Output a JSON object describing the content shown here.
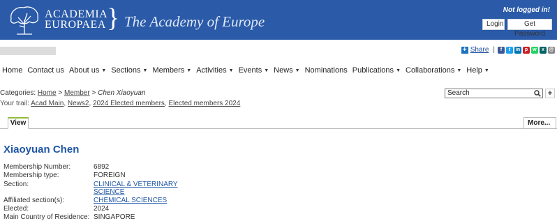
{
  "header": {
    "org_line1": "ACADEMIA",
    "org_line2": "EUROPAEA",
    "title": "The Academy of Europe",
    "login_status": "Not logged in!",
    "login_button": "Login",
    "password_button": "Get Password",
    "banner_color": "#2a5aa8"
  },
  "share": {
    "label": "Share",
    "services": [
      {
        "icon": "facebook-icon",
        "glyph": "f",
        "color": "#3b5998"
      },
      {
        "icon": "twitter-icon",
        "glyph": "t",
        "color": "#1da1f2"
      },
      {
        "icon": "linkedin-icon",
        "glyph": "in",
        "color": "#0077b5"
      },
      {
        "icon": "pinterest-icon",
        "glyph": "p",
        "color": "#cb2027"
      },
      {
        "icon": "whatsapp-icon",
        "glyph": "w",
        "color": "#25d366"
      },
      {
        "icon": "xing-icon",
        "glyph": "x",
        "color": "#026466"
      },
      {
        "icon": "email-icon",
        "glyph": "@",
        "color": "#888888"
      }
    ]
  },
  "nav": [
    {
      "label": "Home",
      "dropdown": false
    },
    {
      "label": "Contact us",
      "dropdown": false
    },
    {
      "label": "About us",
      "dropdown": true
    },
    {
      "label": "Sections",
      "dropdown": true
    },
    {
      "label": "Members",
      "dropdown": true
    },
    {
      "label": "Activities",
      "dropdown": true
    },
    {
      "label": "Events",
      "dropdown": true
    },
    {
      "label": "News",
      "dropdown": true
    },
    {
      "label": "Nominations",
      "dropdown": false
    },
    {
      "label": "Publications",
      "dropdown": true
    },
    {
      "label": "Collaborations",
      "dropdown": true
    },
    {
      "label": "Help",
      "dropdown": true
    }
  ],
  "breadcrumb": {
    "prefix": "Categories:",
    "home": "Home",
    "member": "Member",
    "current": "Chen Xiaoyuan",
    "sep": ">"
  },
  "trail": {
    "prefix": "Your trail:",
    "items": [
      "Acad Main",
      "News2",
      "2024 Elected members",
      "Elected members 2024"
    ]
  },
  "search": {
    "text": "Search"
  },
  "tabs": {
    "view": "View",
    "more": "More..."
  },
  "profile": {
    "name": "Xiaoyuan Chen",
    "fields": [
      {
        "label": "Membership Number:",
        "value": "6892",
        "link": false
      },
      {
        "label": "Membership type:",
        "value": "FOREIGN",
        "link": false
      },
      {
        "label": "Section:",
        "value": "CLINICAL & VETERINARY SCIENCE",
        "value_line1": "CLINICAL & VETERINARY",
        "value_line2": "SCIENCE",
        "link": true
      },
      {
        "label": "Affiliated section(s):",
        "value": "CHEMICAL SCIENCES",
        "link": true
      },
      {
        "label": "Elected:",
        "value": "2024",
        "link": false
      },
      {
        "label": "Main Country of Residence:",
        "value": "SINGAPORE",
        "link": false
      }
    ]
  }
}
